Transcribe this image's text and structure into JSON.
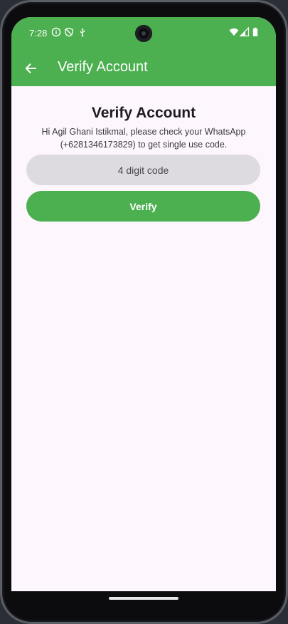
{
  "status_bar": {
    "time": "7:28",
    "left_icons": [
      "info-icon",
      "shield-icon",
      "usb-icon"
    ],
    "right_icons": [
      "wifi-icon",
      "signal-icon",
      "battery-icon"
    ]
  },
  "app_bar": {
    "title": "Verify Account",
    "background": "#4caf50"
  },
  "main": {
    "title": "Verify Account",
    "message": "Hi Agil Ghani Istikmal, please check your WhatsApp (+6281346173829) to get single use code.",
    "code_input": {
      "placeholder": "4 digit code",
      "value": ""
    },
    "verify_label": "Verify"
  },
  "colors": {
    "accent": "#4caf50",
    "background": "#fdf6fd",
    "input_fill": "#dedbe0"
  }
}
